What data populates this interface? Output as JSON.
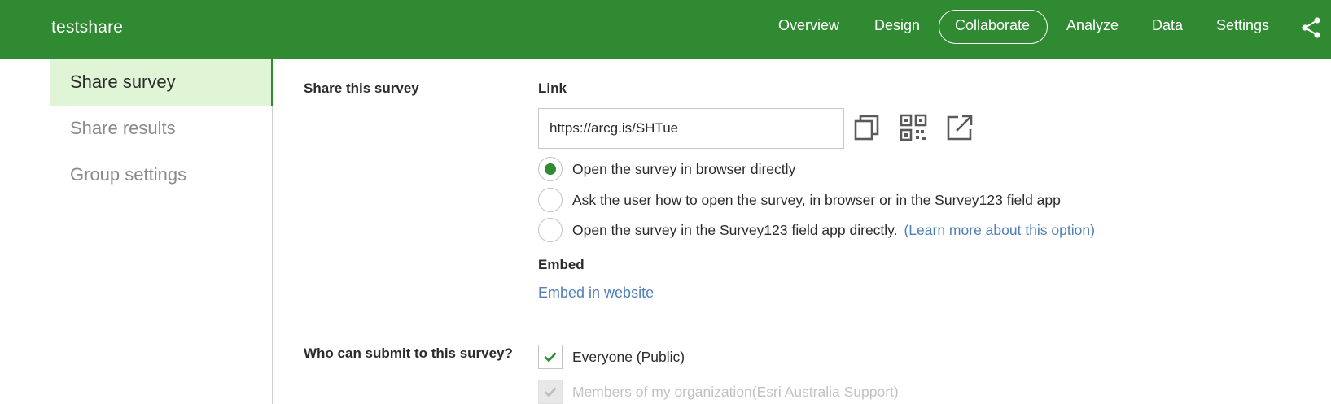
{
  "header": {
    "title": "testshare",
    "nav": [
      "Overview",
      "Design",
      "Collaborate",
      "Analyze",
      "Data",
      "Settings"
    ],
    "active_nav": "Collaborate",
    "accent_color": "#2f8a32"
  },
  "sidebar": {
    "items": [
      {
        "label": "Share survey",
        "active": true
      },
      {
        "label": "Share results",
        "active": false
      },
      {
        "label": "Group settings",
        "active": false
      }
    ]
  },
  "share_section": {
    "title": "Share this survey",
    "link_label": "Link",
    "link_value": "https://arcg.is/SHTue",
    "tool_icons": [
      "copy-icon",
      "qr-code-icon",
      "open-external-icon"
    ],
    "open_options": [
      {
        "label": "Open the survey in browser directly",
        "checked": true
      },
      {
        "label": "Ask the user how to open the survey, in browser or in the Survey123 field app",
        "checked": false
      },
      {
        "label": "Open the survey in the Survey123 field app directly.",
        "checked": false,
        "link": "(Learn more about this option)"
      }
    ],
    "embed_label": "Embed",
    "embed_link": "Embed in website"
  },
  "submit_section": {
    "title": "Who can submit to this survey?",
    "options": [
      {
        "label": "Everyone (Public)",
        "checked": true,
        "disabled": false
      },
      {
        "label": "Members of my organization(Esri Australia Support)",
        "checked": true,
        "disabled": true
      }
    ]
  }
}
